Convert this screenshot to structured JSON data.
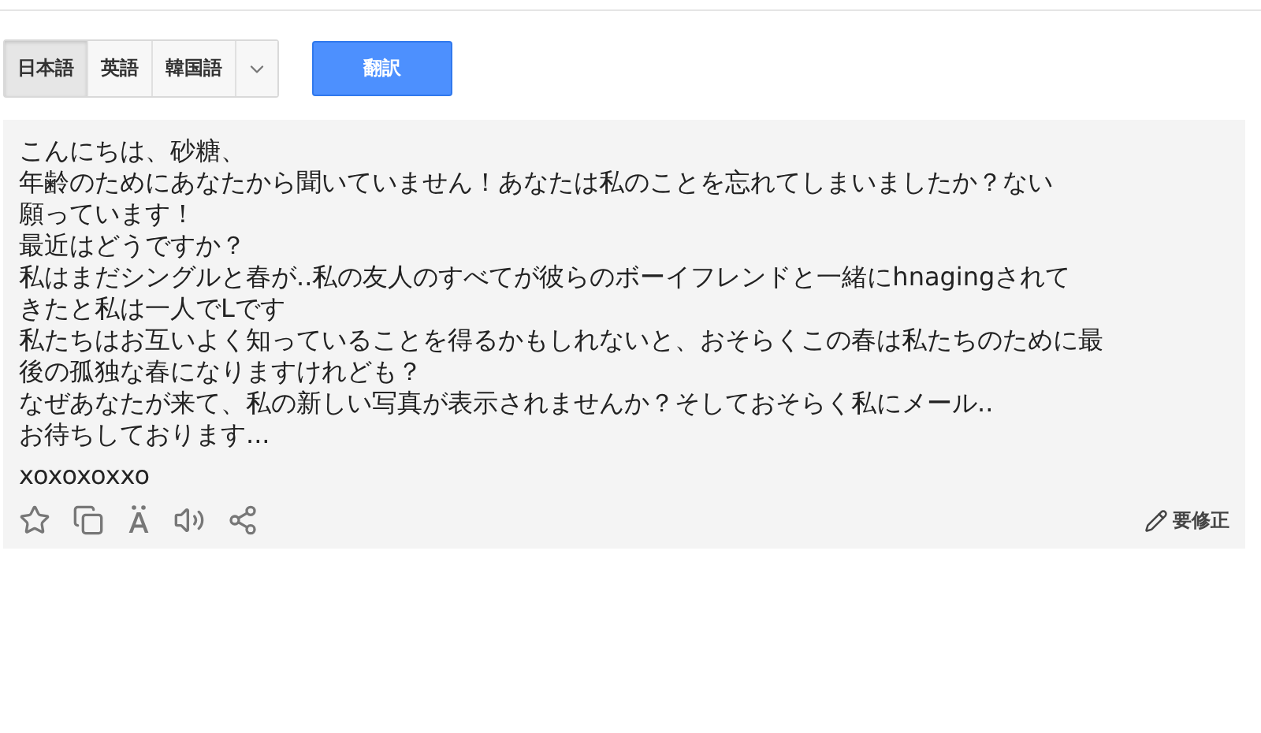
{
  "language_tabs": [
    {
      "label": "日本語",
      "selected": true
    },
    {
      "label": "英語",
      "selected": false
    },
    {
      "label": "韓国語",
      "selected": false
    }
  ],
  "translate_button": "翻訳",
  "text_lines": [
    "こんにちは、砂糖、",
    "年齢のためにあなたから聞いていません！あなたは私のことを忘れてしまいましたか？ない",
    "願っています！",
    "最近はどうですか？",
    "私はまだシングルと春が..私の友人のすべてが彼らのボーイフレンドと一緒にhnagingされて",
    "きたと私は一人でLです",
    "私たちはお互いよく知っていることを得るかもしれないと、おそらくこの春は私たちのために最",
    "後の孤独な春になりますけれども？",
    "なぜあなたが来て、私の新しい写真が表示されませんか？そしておそらく私にメール..",
    "お待ちしております..."
  ],
  "signature": "xoxoxoxxo",
  "suggest_edit": "要修正"
}
